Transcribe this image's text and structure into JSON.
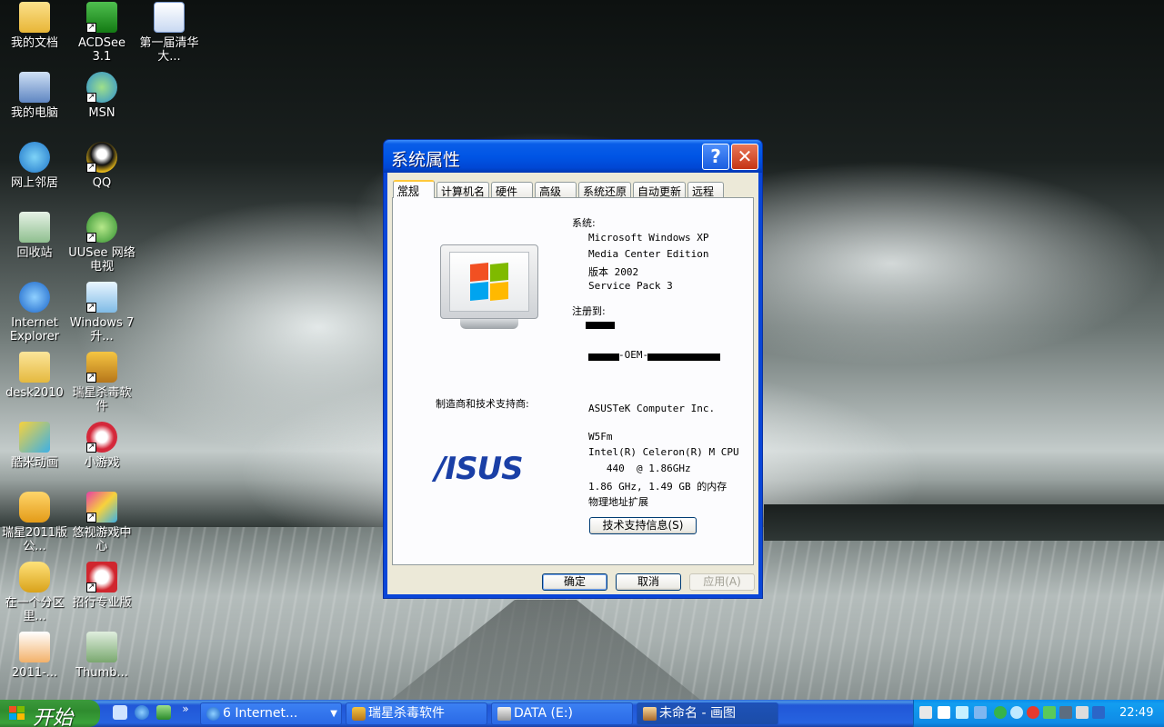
{
  "desktop": {
    "icons": [
      {
        "label": "我的文档"
      },
      {
        "label": "ACDSee 3.1"
      },
      {
        "label": "第一届清华大..."
      },
      {
        "label": "我的电脑"
      },
      {
        "label": "MSN"
      },
      {
        "label": "网上邻居"
      },
      {
        "label": "QQ"
      },
      {
        "label": "回收站"
      },
      {
        "label": "UUSee 网络电视"
      },
      {
        "label": "Internet Explorer"
      },
      {
        "label": "Windows 7 升..."
      },
      {
        "label": "desk2010"
      },
      {
        "label": "瑞星杀毒软件"
      },
      {
        "label": "酷米动画"
      },
      {
        "label": "小游戏"
      },
      {
        "label": "瑞星2011版公..."
      },
      {
        "label": "悠视游戏中心"
      },
      {
        "label": "在一个分区里..."
      },
      {
        "label": "招行专业版"
      },
      {
        "label": "2011-..."
      },
      {
        "label": "Thumb..."
      }
    ]
  },
  "dialog": {
    "title": "系统属性",
    "help_label": "?",
    "close_label": "✕",
    "tabs": [
      {
        "label": "常规"
      },
      {
        "label": "计算机名"
      },
      {
        "label": "硬件"
      },
      {
        "label": "高级"
      },
      {
        "label": "系统还原"
      },
      {
        "label": "自动更新"
      },
      {
        "label": "远程"
      }
    ],
    "system_label": "系统:",
    "system_lines": [
      "Microsoft Windows XP",
      "Media Center Edition",
      "版本 2002",
      "Service Pack 3"
    ],
    "registered_label": "注册到:",
    "product_id_fragment": "-OEM-",
    "manufacturer_label": "制造商和技术支持商:",
    "manufacturer_lines": [
      "ASUSTeK Computer Inc.",
      "W5Fm",
      "Intel(R) Celeron(R) M CPU",
      "   440  @ 1.86GHz",
      "1.86 GHz, 1.49 GB 的内存",
      "物理地址扩展"
    ],
    "asus_logo_text": "/ISUS",
    "support_button": "技术支持信息(S)",
    "ok_button": "确定",
    "cancel_button": "取消",
    "apply_button": "应用(A)"
  },
  "taskbar": {
    "start_label": "开始",
    "quicklaunch_more": "»",
    "tasks": [
      {
        "label": "6 Internet..."
      },
      {
        "label": "瑞星杀毒软件"
      },
      {
        "label": "DATA (E:)"
      },
      {
        "label": "未命名 - 画图"
      }
    ],
    "clock": "22:49"
  },
  "colors": {
    "title_blue": "#0055e5",
    "start_green": "#3c9a3c",
    "tray_blue": "#0f8ae6",
    "asus_blue": "#1a3fa6"
  }
}
